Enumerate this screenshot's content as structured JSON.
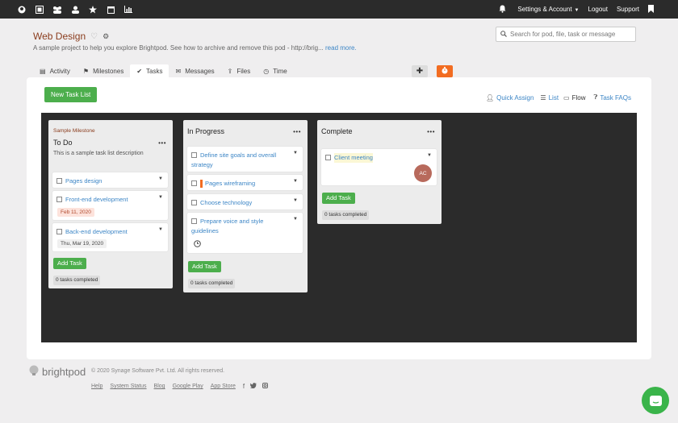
{
  "topbar": {
    "nav_icons": [
      "brightpod-logo-icon",
      "board-icon",
      "team-icon",
      "user-icon",
      "star-icon",
      "calendar-icon",
      "reports-icon"
    ],
    "settings_label": "Settings & Account",
    "logout_label": "Logout",
    "support_label": "Support"
  },
  "project": {
    "title": "Web Design",
    "description": "A sample project to help you explore Brightpod. See how to archive and remove this pod - http://brig...",
    "read_more": "read more."
  },
  "search": {
    "placeholder": "Search for pod, file, task or message"
  },
  "tabs": [
    {
      "label": "Activity",
      "icon": "activity-icon"
    },
    {
      "label": "Milestones",
      "icon": "flag-icon"
    },
    {
      "label": "Tasks",
      "icon": "check-icon",
      "active": true
    },
    {
      "label": "Messages",
      "icon": "envelope-icon"
    },
    {
      "label": "Files",
      "icon": "upload-icon"
    },
    {
      "label": "Time",
      "icon": "clock-icon"
    }
  ],
  "toolbar": {
    "new_list_label": "New Task List",
    "quick_assign": "Quick Assign",
    "list": "List",
    "flow": "Flow",
    "task_faqs": "Task FAQs"
  },
  "lists": [
    {
      "milestone": "Sample Milestone",
      "title": "To Do",
      "description": "This is a sample task list description",
      "tasks": [
        {
          "title": "Pages design"
        },
        {
          "title": "Front-end development",
          "date": "Feb 11, 2020",
          "date_status": "overdue"
        },
        {
          "title": "Back-end development",
          "date": "Thu, Mar 19, 2020",
          "date_status": "normal"
        }
      ],
      "add_task": "Add Task",
      "completed": "0 tasks completed"
    },
    {
      "title": "In Progress",
      "tasks": [
        {
          "title": "Define site goals and overall",
          "title2": "strategy"
        },
        {
          "title": "Pages wireframing",
          "flag": true
        },
        {
          "title": "Choose technology"
        },
        {
          "title": "Prepare voice and style",
          "title2": "guidelines",
          "timer": true
        }
      ],
      "add_task": "Add Task",
      "completed": "0 tasks completed"
    },
    {
      "title": "Complete",
      "tasks": [
        {
          "title": "Client meeting",
          "assignee": "AC"
        }
      ],
      "add_task": "Add Task",
      "completed": "0 tasks completed"
    }
  ],
  "footer": {
    "logo": "brightpod",
    "copyright": "© 2020 Synage Software Pvt. Ltd. All rights reserved.",
    "links": [
      "Help",
      "System Status",
      "Blog",
      "Google Play",
      "App Store"
    ],
    "social": [
      "facebook-icon",
      "twitter-icon",
      "instagram-icon"
    ]
  },
  "colors": {
    "accent": "#3d86c6",
    "green": "#4cae4c",
    "orange": "#f26c21",
    "board": "#2b2b2b",
    "title": "#8a3c1d"
  }
}
